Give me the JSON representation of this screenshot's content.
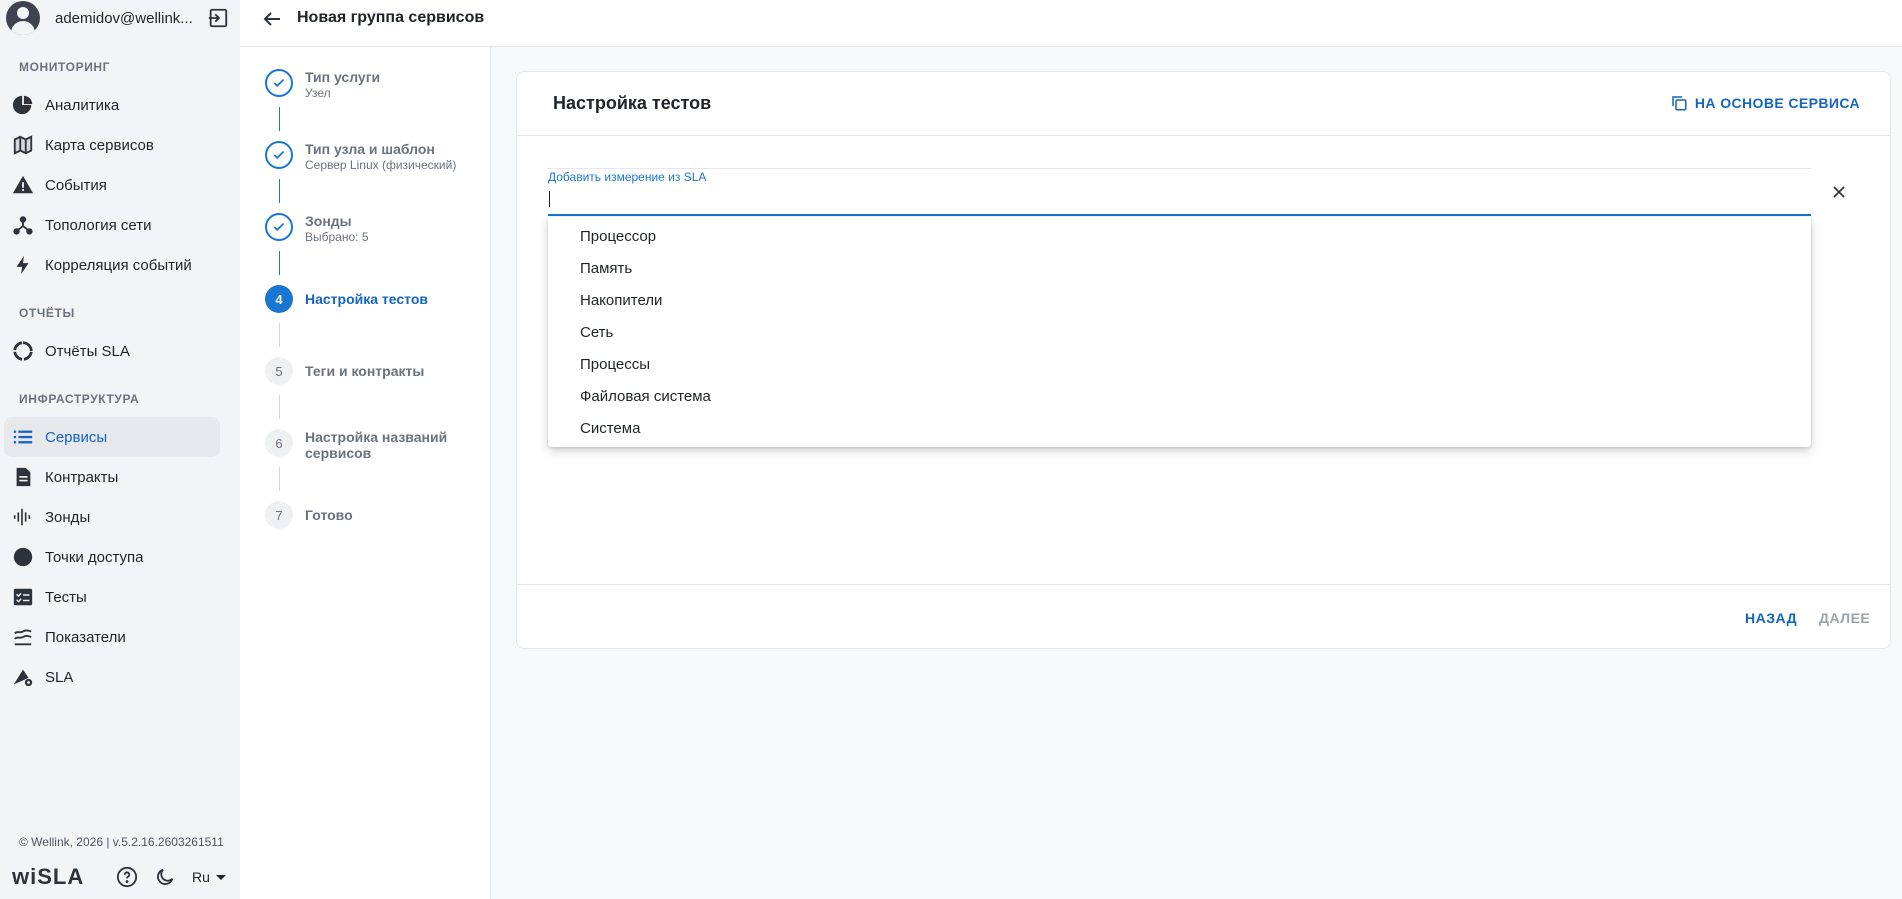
{
  "header": {
    "title": "Новая группа сервисов"
  },
  "user": {
    "name": "ademidov@wellink..."
  },
  "sidebar": {
    "sections": [
      {
        "label": "МОНИТОРИНГ"
      },
      {
        "label": "ОТЧЁТЫ"
      },
      {
        "label": "ИНФРАСТРУКТУРА"
      }
    ],
    "items": [
      {
        "label": "Аналитика",
        "icon": "pie-chart-icon"
      },
      {
        "label": "Карта сервисов",
        "icon": "map-icon"
      },
      {
        "label": "События",
        "icon": "warning-icon"
      },
      {
        "label": "Топология сети",
        "icon": "topology-icon"
      },
      {
        "label": "Корреляция событий",
        "icon": "bolt-icon"
      },
      {
        "label": "Отчёты SLA",
        "icon": "donut-icon"
      },
      {
        "label": "Сервисы",
        "icon": "list-icon",
        "active": true
      },
      {
        "label": "Контракты",
        "icon": "document-icon"
      },
      {
        "label": "Зонды",
        "icon": "probe-icon"
      },
      {
        "label": "Точки доступа",
        "icon": "circle-icon"
      },
      {
        "label": "Тесты",
        "icon": "checklist-icon"
      },
      {
        "label": "Показатели",
        "icon": "layers-icon"
      },
      {
        "label": "SLA",
        "icon": "sla-icon"
      }
    ],
    "footer": {
      "copyright": "© Wellink, 2026 | v.5.2.16.2603261511",
      "logo": "wiSLA",
      "lang": "Ru"
    }
  },
  "stepper": {
    "steps": [
      {
        "num": "1",
        "title": "Тип услуги",
        "sub": "Узел",
        "state": "done"
      },
      {
        "num": "2",
        "title": "Тип узла и шаблон",
        "sub": "Сервер Linux (физический)",
        "state": "done"
      },
      {
        "num": "3",
        "title": "Зонды",
        "sub": "Выбрано: 5",
        "state": "done"
      },
      {
        "num": "4",
        "title": "Настройка тестов",
        "sub": "",
        "state": "current"
      },
      {
        "num": "5",
        "title": "Теги и контракты",
        "sub": "",
        "state": "todo"
      },
      {
        "num": "6",
        "title": "Настройка названий сервисов",
        "sub": "",
        "state": "todo"
      },
      {
        "num": "7",
        "title": "Готово",
        "sub": "",
        "state": "todo"
      }
    ]
  },
  "card": {
    "title": "Настройка тестов",
    "copy_button": "НА ОСНОВЕ СЕРВИСА",
    "field_label": "Добавить измерение из SLA",
    "field_value": "",
    "options": [
      "Процессор",
      "Память",
      "Накопители",
      "Сеть",
      "Процессы",
      "Файловая система",
      "Система"
    ],
    "back_button": "НАЗАД",
    "next_button": "ДАЛЕЕ"
  },
  "colors": {
    "accent": "#1976d2",
    "accent_text": "#1565c0",
    "disabled": "#9ca3af"
  }
}
